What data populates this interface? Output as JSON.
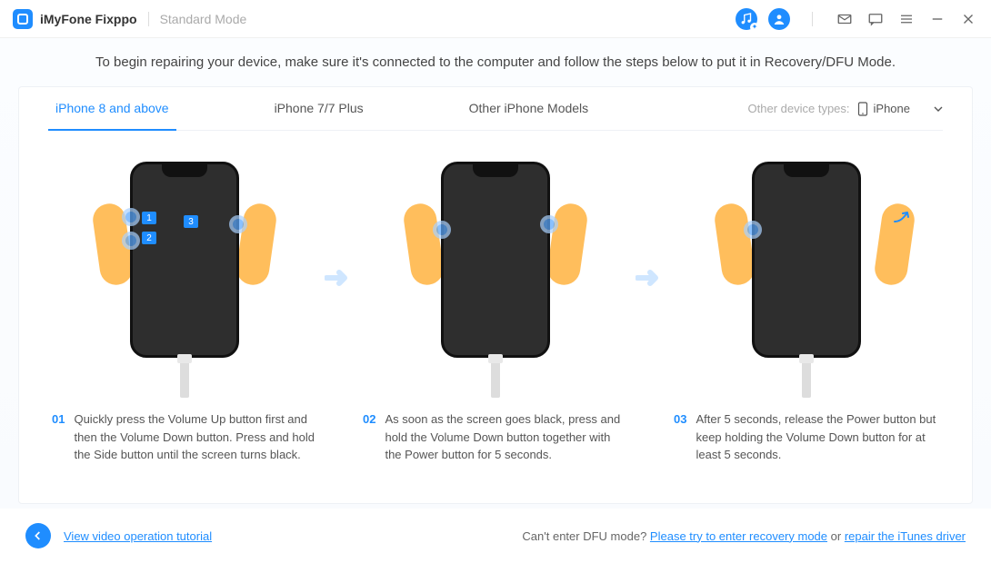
{
  "header": {
    "app_name": "iMyFone Fixppo",
    "mode": "Standard Mode"
  },
  "intro": "To begin repairing your device, make sure it's connected to the computer and follow the steps below to put it in Recovery/DFU Mode.",
  "tabs": {
    "items": [
      {
        "label": "iPhone 8 and above"
      },
      {
        "label": "iPhone 7/7 Plus"
      },
      {
        "label": "Other iPhone Models"
      }
    ],
    "other_label": "Other device types:",
    "selected_device": "iPhone"
  },
  "steps": [
    {
      "num": "01",
      "text": "Quickly press the Volume Up button first and then the Volume Down button. Press and hold the Side button until the screen turns black."
    },
    {
      "num": "02",
      "text": "As soon as the screen goes black, press and hold the Volume Down button together with the Power button for 5 seconds."
    },
    {
      "num": "03",
      "text": "After 5 seconds, release the Power button but keep holding the Volume Down button for at least 5 seconds."
    }
  ],
  "badges": {
    "b1": "1",
    "b2": "2",
    "b3": "3"
  },
  "footer": {
    "tutorial_link": "View video operation tutorial",
    "cant_enter": "Can't enter DFU mode? ",
    "recovery_link": "Please try to enter recovery mode",
    "or": " or ",
    "driver_link": "repair the iTunes driver"
  }
}
